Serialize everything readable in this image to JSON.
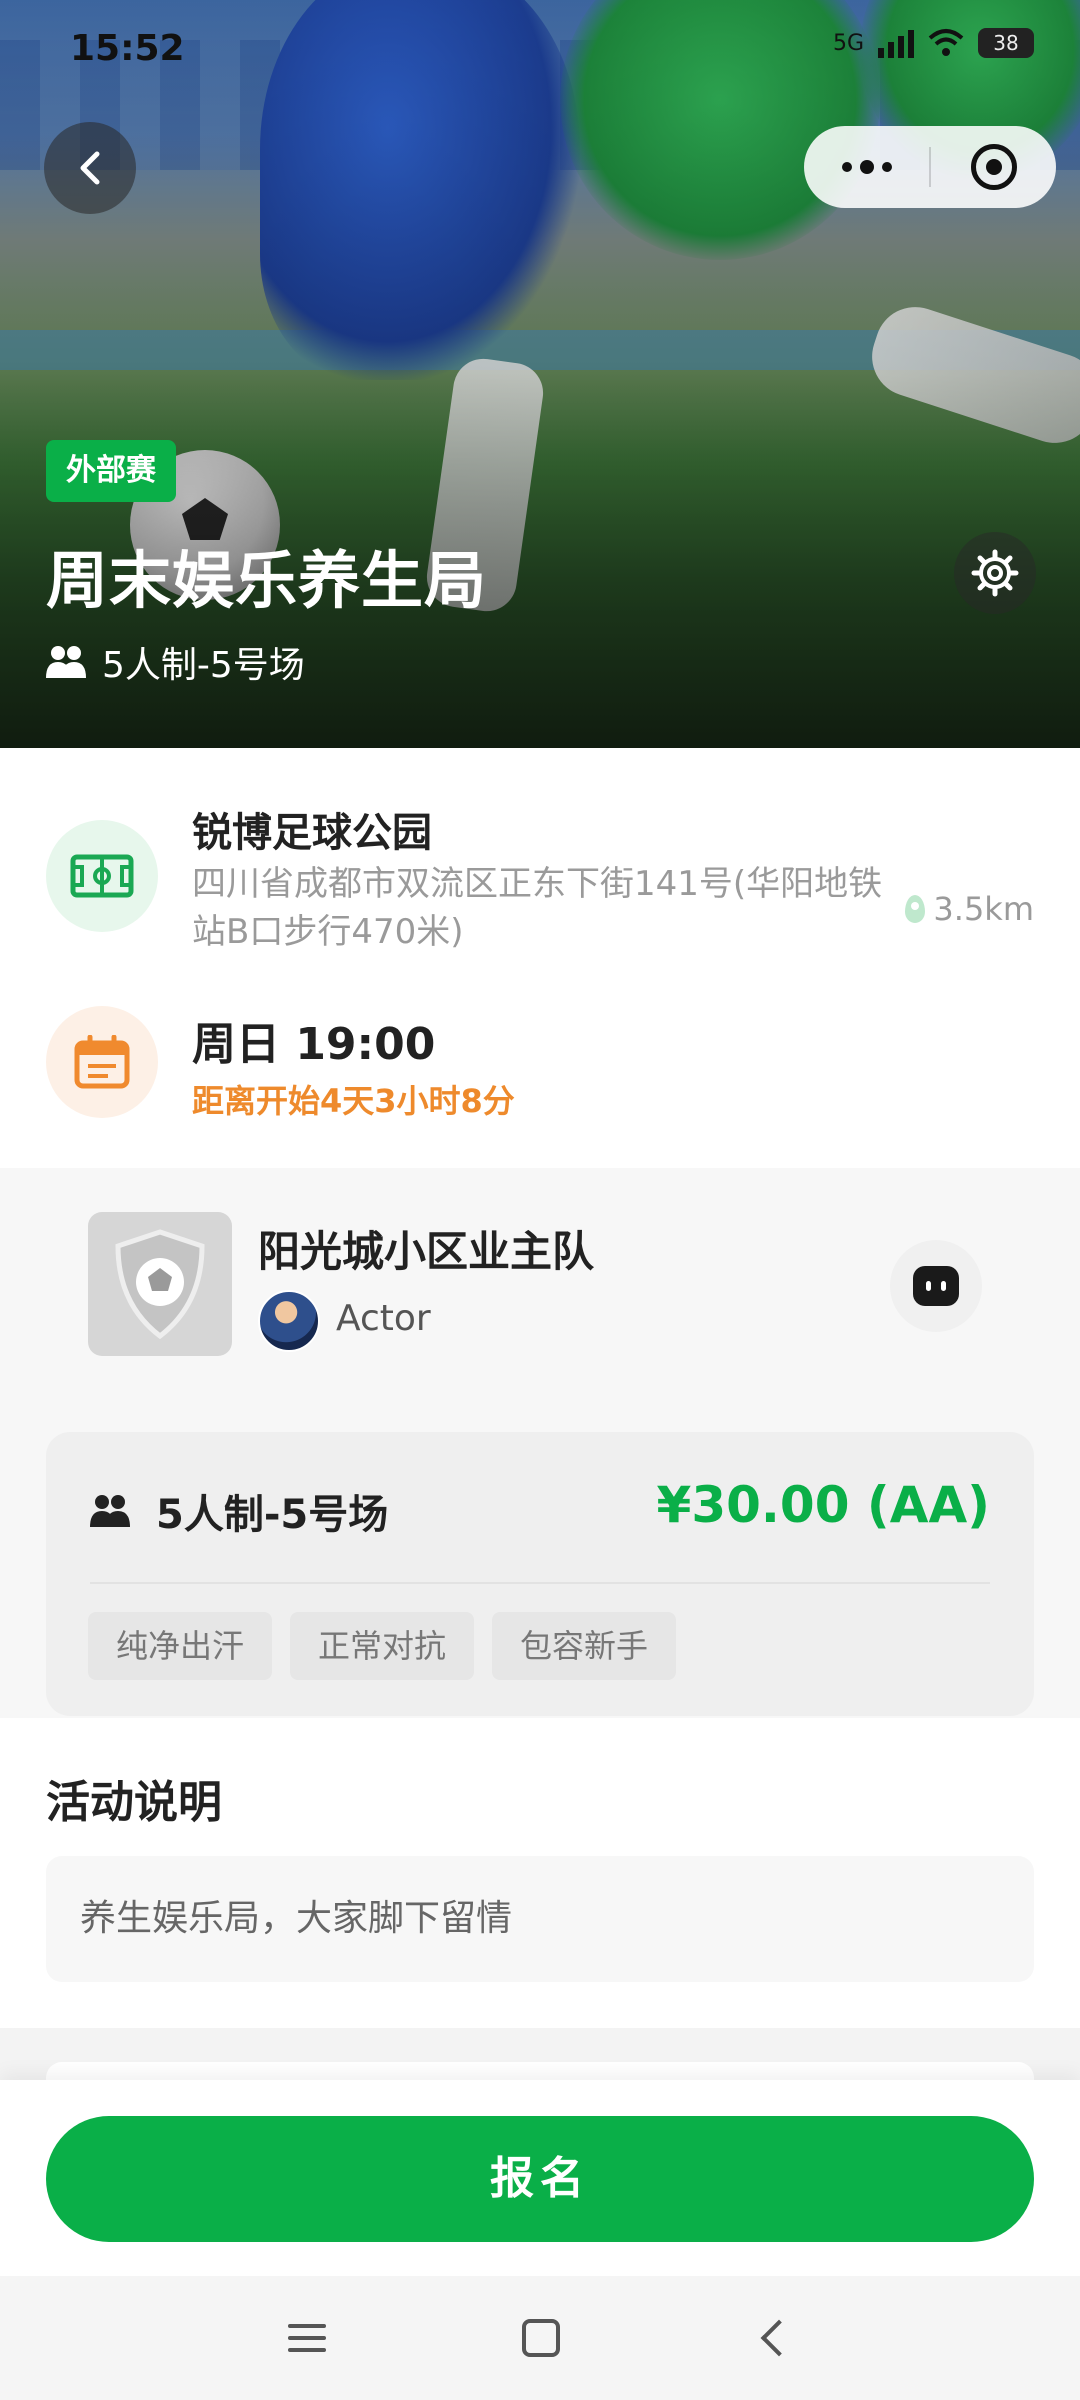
{
  "status_bar": {
    "time": "15:52",
    "network": "5G",
    "battery": "38"
  },
  "hero": {
    "tag": "外部赛",
    "title": "周末娱乐养生局",
    "format": "5人制-5号场"
  },
  "venue": {
    "name": "锐博足球公园",
    "address": "四川省成都市双流区正东下街141号(华阳地铁站B口步行470米)",
    "distance": "3.5km"
  },
  "schedule": {
    "time": "周日 19:00",
    "countdown": "距离开始4天3小时8分"
  },
  "team": {
    "name": "阳光城小区业主队",
    "organizer": "Actor"
  },
  "match_card": {
    "format": "5人制-5号场",
    "price": "¥30.00 (AA)",
    "tags": [
      "纯净出汗",
      "正常对抗",
      "包容新手"
    ]
  },
  "description": {
    "title": "活动说明",
    "text": "养生娱乐局，大家脚下留情"
  },
  "action": {
    "signup_label": "报名"
  },
  "colors": {
    "primary_green": "#0aaf48",
    "countdown_orange": "#ee8a2c"
  }
}
